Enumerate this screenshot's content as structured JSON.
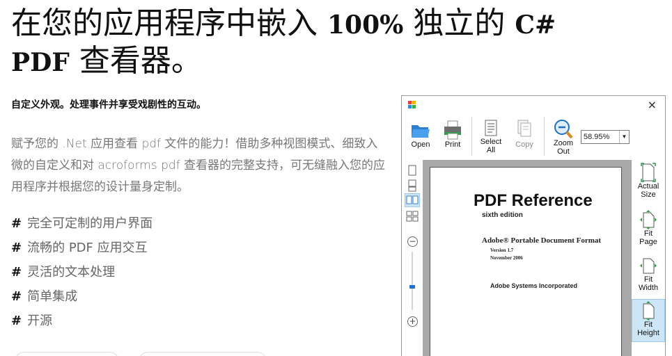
{
  "hero": {
    "title_part1": "在您的应用程序中嵌入 ",
    "title_bold1": "100%",
    "title_part2": " 独立的 ",
    "title_bold2": "C#",
    "title_bold3": "PDF",
    "title_part3": " 查看器。"
  },
  "subtitle": "自定义外观。处理事件并享受戏剧性的互动。",
  "description": "赋予您的 .Net 应用查看 pdf 文件的能力！借助多种视图模式、细致入微的自定义和对 acroforms pdf 查看器的完整支持，可无缝融入您的应用程序并根据您的设计量身定制。",
  "features": [
    {
      "hash": "#",
      "text": "完全可定制的用户界面"
    },
    {
      "hash": "#",
      "text": "流畅的 PDF 应用交互"
    },
    {
      "hash": "#",
      "text": "灵活的文本处理"
    },
    {
      "hash": "#",
      "text": "简单集成"
    },
    {
      "hash": "#",
      "text": "开源"
    }
  ],
  "viewer": {
    "close_glyph": "×",
    "toolbar": {
      "open": "Open",
      "print": "Print",
      "select_all": "Select All",
      "copy": "Copy",
      "zoom_out": "Zoom Out",
      "zoom_value": "58.95%"
    },
    "side": {
      "actual_size": "Actual Size",
      "fit_page": "Fit Page",
      "fit_width": "Fit Width",
      "fit_height": "Fit Height",
      "zoom_minus": "−",
      "zoom_plus": "+"
    },
    "document": {
      "title": "PDF Reference",
      "edition": "sixth edition",
      "format": "Adobe® Portable Document Format",
      "version": "Version 1.7",
      "date": "November 2006",
      "company": "Adobe Systems Incorporated"
    },
    "colors": {
      "accent": "#1e6fd0",
      "active_bg": "#cde6f7",
      "doc_bg": "#a8a8a8"
    }
  }
}
